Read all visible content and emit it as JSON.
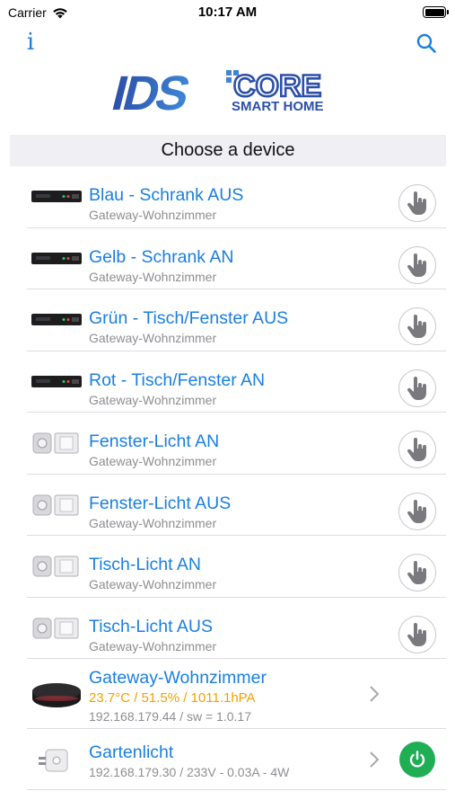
{
  "status": {
    "carrier": "Carrier",
    "time": "10:17 AM"
  },
  "nav": {
    "info_label": "i"
  },
  "logo": {
    "brand": "IDS",
    "product": "CORE",
    "tagline": "SMART HOME"
  },
  "section": {
    "title": "Choose a device"
  },
  "devices": [
    {
      "title": "Blau - Schrank AUS",
      "subtitle": "Gateway-Wohnzimmer",
      "kind": "remote-icon",
      "action": "hand-tap-icon"
    },
    {
      "title": "Gelb - Schrank AN",
      "subtitle": "Gateway-Wohnzimmer",
      "kind": "remote-icon",
      "action": "hand-tap-icon"
    },
    {
      "title": "Grün - Tisch/Fenster AUS",
      "subtitle": "Gateway-Wohnzimmer",
      "kind": "remote-icon",
      "action": "hand-tap-icon"
    },
    {
      "title": "Rot - Tisch/Fenster AN",
      "subtitle": "Gateway-Wohnzimmer",
      "kind": "remote-icon",
      "action": "hand-tap-icon"
    },
    {
      "title": "Fenster-Licht AN",
      "subtitle": "Gateway-Wohnzimmer",
      "kind": "socket-switch-icon",
      "action": "hand-tap-icon"
    },
    {
      "title": "Fenster-Licht AUS",
      "subtitle": "Gateway-Wohnzimmer",
      "kind": "socket-switch-icon",
      "action": "hand-tap-icon"
    },
    {
      "title": "Tisch-Licht AN",
      "subtitle": "Gateway-Wohnzimmer",
      "kind": "socket-switch-icon",
      "action": "hand-tap-icon"
    },
    {
      "title": "Tisch-Licht AUS",
      "subtitle": "Gateway-Wohnzimmer",
      "kind": "socket-switch-icon",
      "action": "hand-tap-icon"
    }
  ],
  "gateway": {
    "title": "Gateway-Wohnzimmer",
    "climate": "23.7°C / 51.5% / 1011.1hPA",
    "network": "192.168.179.44 / sw = 1.0.17",
    "icon": "gateway-hub-icon"
  },
  "plug": {
    "title": "Gartenlicht",
    "network": "192.168.179.30 / 233V - 0.03A - 4W",
    "icon": "smart-plug-icon",
    "power_state": "on",
    "power_color": "#1fae54"
  },
  "colors": {
    "accent": "#1a7fe0",
    "temperature": "#f2a100",
    "subtitle": "#8e8e93"
  }
}
